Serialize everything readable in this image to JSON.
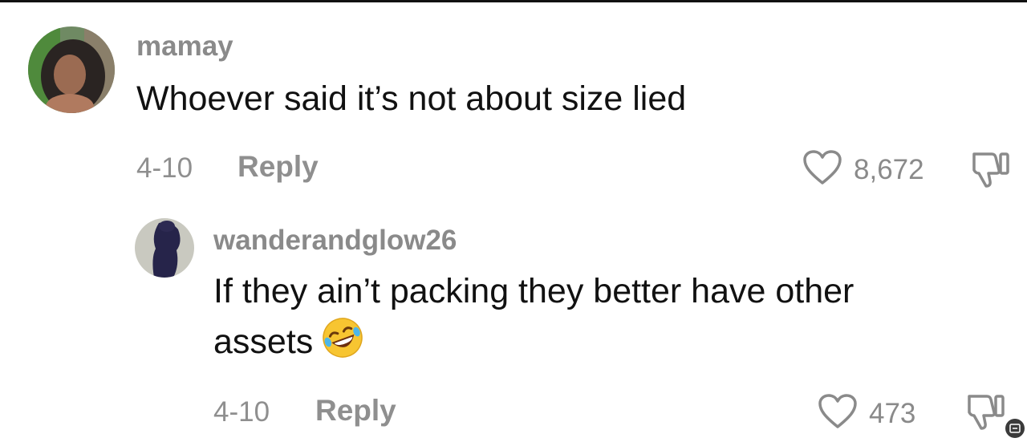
{
  "comments": [
    {
      "username": "mamay",
      "text": "Whoever said it’s not about size lied",
      "date": "4-10",
      "reply_label": "Reply",
      "likes": "8,672",
      "avatar_icon": "avatar-photo"
    },
    {
      "username": "wanderandglow26",
      "text_line1": "If they ain’t packing they better have other",
      "text_line2": "assets",
      "emoji": "rolling-on-floor-laughing-emoji",
      "date": "4-10",
      "reply_label": "Reply",
      "likes": "473",
      "avatar_icon": "avatar-photo"
    }
  ],
  "icons": {
    "like": "heart-outline-icon",
    "dislike": "thumbs-down-outline-icon"
  },
  "colors": {
    "text_primary": "#111111",
    "text_secondary": "#8a8a8a",
    "background": "#ffffff"
  }
}
